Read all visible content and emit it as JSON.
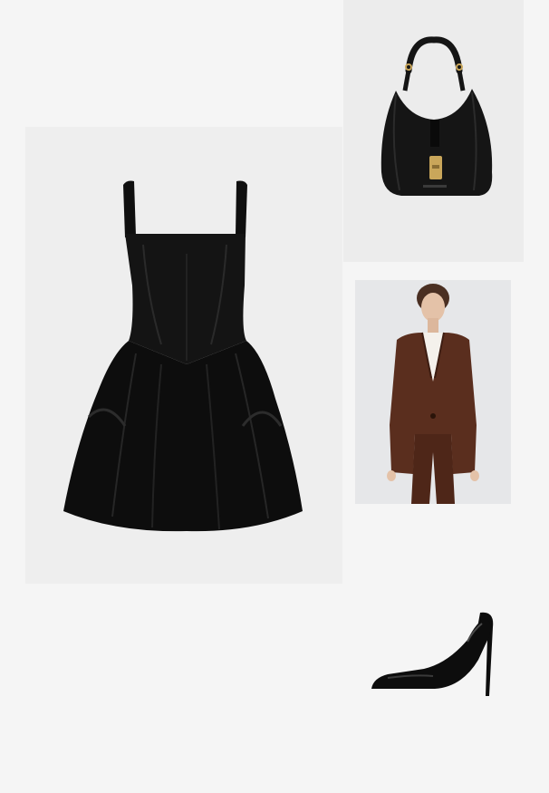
{
  "board": {
    "background": "#f5f5f5"
  },
  "items": [
    {
      "id": "dress",
      "icon": "black-satin-mini-dress-image",
      "color": "#111111"
    },
    {
      "id": "bag",
      "icon": "black-leather-hobo-bag-image",
      "color": "#151515",
      "hardware_color": "#c9a65a"
    },
    {
      "id": "blazer",
      "icon": "brown-suit-model-image",
      "color": "#5a2e1e"
    },
    {
      "id": "pump",
      "icon": "black-patent-stiletto-pump-image",
      "color": "#0d0d0d"
    }
  ]
}
